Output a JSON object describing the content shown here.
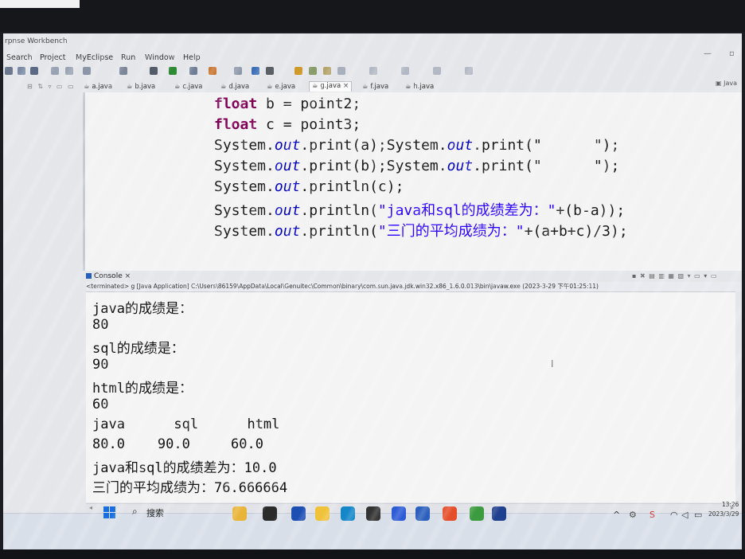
{
  "window": {
    "title": "rpnse Workbench"
  },
  "menubar": {
    "items": [
      "Search",
      "Project",
      "MyEclipse",
      "Run",
      "Window",
      "Help"
    ]
  },
  "perspective": {
    "label": "Java"
  },
  "editor_tabs": [
    "a.java",
    "b.java",
    "c.java",
    "d.java",
    "e.java",
    "g.java",
    "f.java",
    "h.java"
  ],
  "editor": {
    "lines": [
      [
        {
          "t": "float",
          "c": "kw"
        },
        {
          "t": " b = point2;",
          "c": ""
        }
      ],
      [
        {
          "t": "float",
          "c": "kw"
        },
        {
          "t": " c = point3;",
          "c": ""
        }
      ],
      [
        {
          "t": "System.",
          "c": ""
        },
        {
          "t": "out",
          "c": "fld"
        },
        {
          "t": ".print(a);System.",
          "c": ""
        },
        {
          "t": "out",
          "c": "fld"
        },
        {
          "t": ".print(\"      \");",
          "c": ""
        }
      ],
      [
        {
          "t": "System.",
          "c": ""
        },
        {
          "t": "out",
          "c": "fld"
        },
        {
          "t": ".print(b);System.",
          "c": ""
        },
        {
          "t": "out",
          "c": "fld"
        },
        {
          "t": ".print(\"      \");",
          "c": ""
        }
      ],
      [
        {
          "t": "System.",
          "c": ""
        },
        {
          "t": "out",
          "c": "fld"
        },
        {
          "t": ".println(c);",
          "c": ""
        }
      ],
      [
        {
          "t": "System.",
          "c": ""
        },
        {
          "t": "out",
          "c": "fld"
        },
        {
          "t": ".println(",
          "c": ""
        },
        {
          "t": "\"java和sql的成绩差为：\"",
          "c": "str"
        },
        {
          "t": "+(b-a));",
          "c": ""
        }
      ],
      [
        {
          "t": "System.",
          "c": ""
        },
        {
          "t": "out",
          "c": "fld"
        },
        {
          "t": ".println(",
          "c": ""
        },
        {
          "t": "\"三门的平均成绩为：\"",
          "c": "str"
        },
        {
          "t": "+(a+b+c)/3);",
          "c": ""
        }
      ]
    ]
  },
  "console": {
    "tab_label": "Console",
    "terminated": "<terminated> g [Java Application] C:\\Users\\86159\\AppData\\Local\\Genuitec\\Common\\binary\\com.sun.java.jdk.win32.x86_1.6.0.013\\bin\\javaw.exe (2023-3-29 下午01:25:11)",
    "output": [
      "java的成绩是：",
      "80",
      "sql的成绩是：",
      "90",
      "html的成绩是：",
      "60",
      "java      sql      html",
      "80.0    90.0     60.0",
      "java和sql的成绩差为：10.0",
      "三门的平均成绩为：76.666664"
    ]
  },
  "taskbar": {
    "search_label": "搜索",
    "clock_time": "13:26",
    "clock_date": "2023/3/29",
    "apps": [
      {
        "name": "file-explorer",
        "color": "#e9b43a"
      },
      {
        "name": "camera",
        "color": "#2b2b2b"
      },
      {
        "name": "store",
        "color": "#1d4fb3"
      },
      {
        "name": "folder",
        "color": "#f0c23a"
      },
      {
        "name": "edge",
        "color": "#1587c9"
      },
      {
        "name": "app-dark",
        "color": "#333333"
      },
      {
        "name": "myeclipse",
        "color": "#2d5bd6"
      },
      {
        "name": "word",
        "color": "#2b5fbd"
      },
      {
        "name": "chrome",
        "color": "#e44e2b"
      },
      {
        "name": "tree-app",
        "color": "#3b9b3e"
      },
      {
        "name": "pen-app",
        "color": "#1f3f8f"
      }
    ]
  }
}
